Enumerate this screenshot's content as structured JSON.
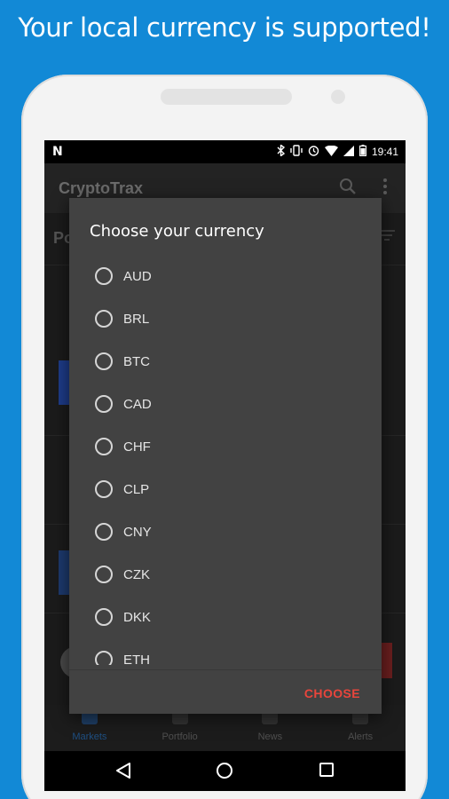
{
  "headline": "Your local currency is supported!",
  "status_bar": {
    "left_icon": "N",
    "time": "19:41",
    "icons": [
      "bluetooth-icon",
      "vibrate-icon",
      "alarm-icon",
      "wifi-icon",
      "signal-icon",
      "battery-icon"
    ]
  },
  "app_bar": {
    "title": "CryptoTrax",
    "icons": [
      "search-icon",
      "more-vert-icon"
    ]
  },
  "behind": {
    "section_label": "Po"
  },
  "bottom_nav": {
    "tabs": [
      {
        "label": "Markets",
        "icon": "chart-icon",
        "active": true
      },
      {
        "label": "Portfolio",
        "icon": "wallet-icon",
        "active": false
      },
      {
        "label": "News",
        "icon": "news-icon",
        "active": false
      },
      {
        "label": "Alerts",
        "icon": "bell-icon",
        "active": false
      }
    ]
  },
  "system_nav": [
    "back-icon",
    "home-icon",
    "recents-icon"
  ],
  "dialog": {
    "title": "Choose your currency",
    "options": [
      "AUD",
      "BRL",
      "BTC",
      "CAD",
      "CHF",
      "CLP",
      "CNY",
      "CZK",
      "DKK",
      "ETH"
    ],
    "action_label": "CHOOSE"
  },
  "colors": {
    "background": "#1289d6",
    "dialog": "#424242",
    "accent": "#e8453c"
  }
}
